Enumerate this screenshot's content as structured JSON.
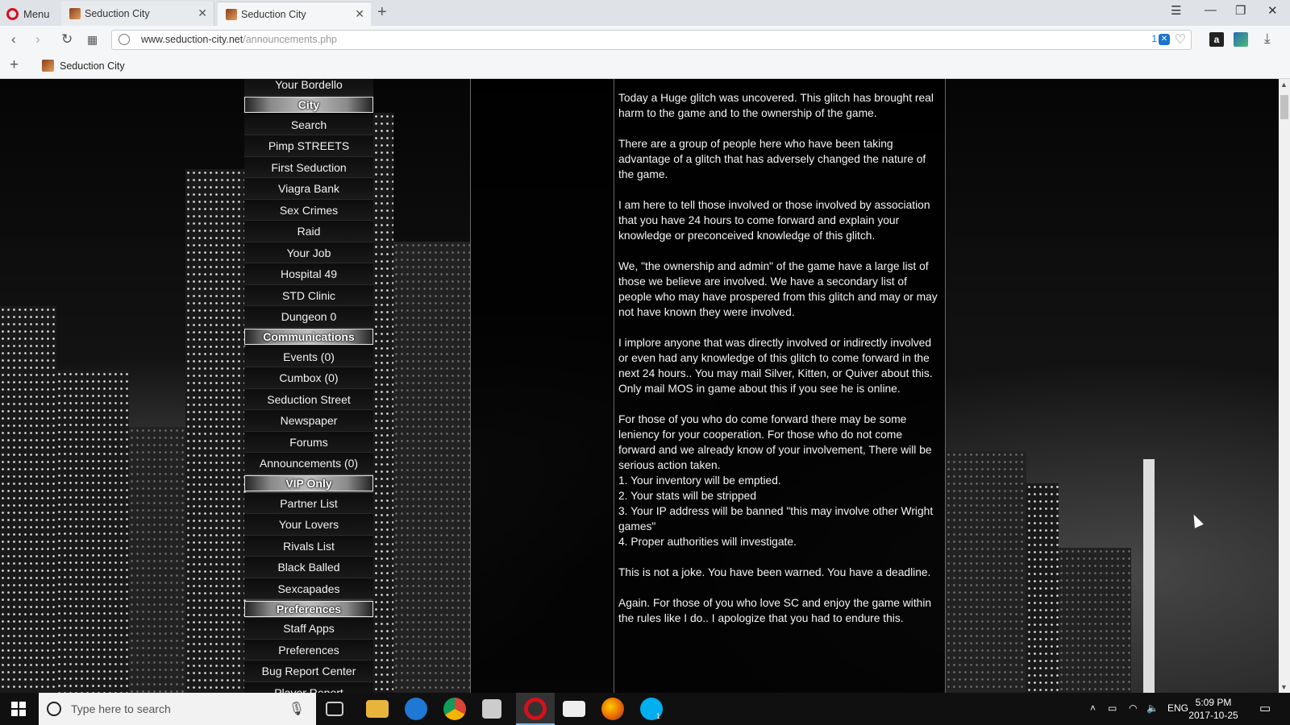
{
  "browser": {
    "menu_label": "Menu",
    "tabs": [
      {
        "title": "Seduction City",
        "active": false
      },
      {
        "title": "Seduction City",
        "active": true
      }
    ],
    "url_host": "www.seduction-city.net",
    "url_path": "/announcements.php",
    "ad_block_count": "1",
    "bookmark": "Seduction City"
  },
  "sidebar": {
    "top_item": "Your Bordello",
    "sections": [
      {
        "heading": "City",
        "items": [
          "Search",
          "Pimp STREETS",
          "First Seduction",
          "Viagra Bank",
          "Sex Crimes",
          "Raid",
          "Your Job",
          "Hospital 49",
          "STD Clinic",
          "Dungeon 0"
        ]
      },
      {
        "heading": "Communications",
        "items": [
          "Events (0)",
          "Cumbox (0)",
          "Seduction Street",
          "Newspaper",
          "Forums",
          "Announcements (0)"
        ]
      },
      {
        "heading": "VIP Only",
        "items": [
          "Partner List",
          "Your Lovers",
          "Rivals List",
          "Black Balled",
          "Sexcapades"
        ]
      },
      {
        "heading": "Preferences",
        "items": [
          "Staff Apps",
          "Preferences",
          "Bug Report Center",
          "Player Report"
        ]
      }
    ]
  },
  "announcement": {
    "paragraphs": [
      "Today a Huge glitch was uncovered. This glitch has brought real harm to the game and to the ownership of the game.",
      "There are a group of people here who have been taking advantage of a glitch that has adversely changed the nature of the game.",
      "I am here to tell those involved or those involved by association that you have 24 hours to come forward and explain your knowledge or preconceived knowledge of this glitch.",
      "We, \"the ownership and admin\" of the game have a large list of those we believe are involved. We have a secondary list of people who may have prospered from this glitch and may or may not have known they were involved.",
      "I implore anyone that was directly involved or indirectly involved or even had any knowledge of this glitch to come forward in the next 24 hours.. You may mail Silver, Kitten, or Quiver about this. Only mail MOS in game about this if you see he is online.",
      "For those of you who do come forward there may be some leniency for your cooperation. For those who do not come forward and we already know of your involvement, There will be serious action taken."
    ],
    "list": [
      "1. Your inventory will be emptied.",
      "2. Your stats will be stripped",
      "3. Your IP address will be banned \"this may involve other Wright games\"",
      "4. Proper authorities will investigate."
    ],
    "warning": "This is not a joke. You have been warned. You have a deadline.",
    "closing": "Again. For those of you who love SC and enjoy the game within the rules like I do.. I apologize that you had to endure this."
  },
  "taskbar": {
    "search_placeholder": "Type here to search",
    "language": "ENG",
    "time": "5:09 PM",
    "date": "2017-10-25",
    "skype_badge": "1"
  },
  "icons": {
    "opera": "opera-icon",
    "amazon": "amazon-icon",
    "download": "download-icon"
  },
  "colors": {
    "opera_red": "#d3111c",
    "adblock_blue": "#1b75d0",
    "taskbar": "#101010"
  }
}
